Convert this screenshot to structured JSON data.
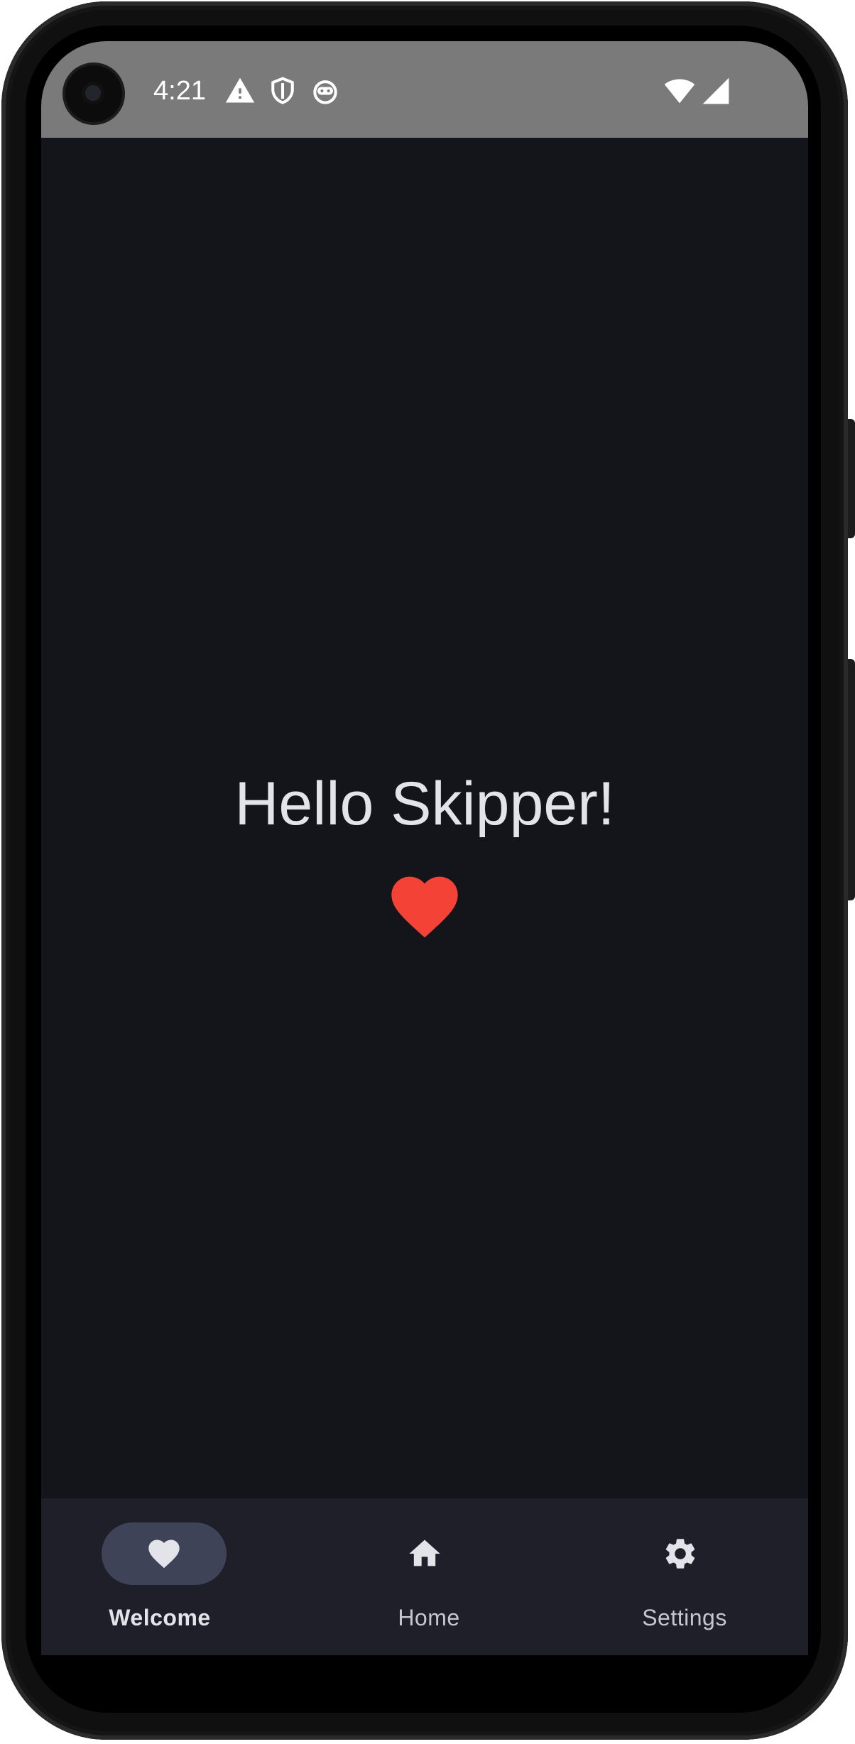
{
  "status_bar": {
    "time": "4:21",
    "icons": [
      "warning-icon",
      "shield-icon",
      "android-face-icon",
      "wifi-icon",
      "cellular-signal-icon"
    ]
  },
  "main": {
    "greeting": "Hello Skipper!",
    "heart_color": "#f44336"
  },
  "bottom_nav": {
    "selected": "Welcome",
    "items": [
      {
        "label": "Welcome",
        "icon": "heart-icon"
      },
      {
        "label": "Home",
        "icon": "home-icon"
      },
      {
        "label": "Settings",
        "icon": "gear-icon"
      }
    ]
  },
  "colors": {
    "background": "#14151b",
    "status_bar": "#7a7a7a",
    "nav_bar": "#1e1f29",
    "nav_indicator": "#3f4357",
    "text": "#e3e3ea"
  }
}
